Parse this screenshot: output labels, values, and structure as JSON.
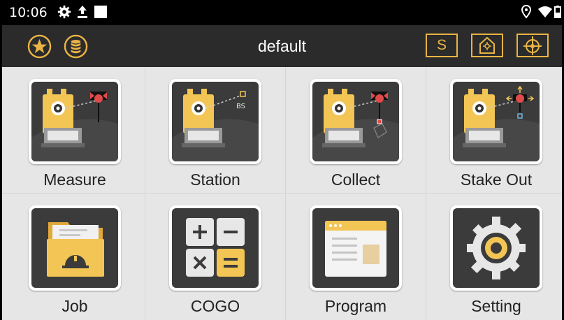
{
  "status_bar": {
    "time": "10:06",
    "icons": [
      "gear-icon",
      "upload-icon",
      "square-icon",
      "location-icon",
      "wifi-icon",
      "battery-icon"
    ]
  },
  "app_bar": {
    "title": "default",
    "left_icons": [
      "star-icon",
      "database-icon"
    ],
    "right_buttons": [
      {
        "label": "S",
        "name": "s-button"
      },
      {
        "label": "",
        "name": "home-target-icon"
      },
      {
        "label": "",
        "name": "crosshair-icon"
      }
    ],
    "accent": "#e9b445"
  },
  "menu": {
    "items": [
      {
        "label": "Measure",
        "icon": "total-station-measure-icon"
      },
      {
        "label": "Station",
        "icon": "total-station-backsight-icon",
        "caption": "BS"
      },
      {
        "label": "Collect",
        "icon": "total-station-collect-icon"
      },
      {
        "label": "Stake Out",
        "icon": "total-station-stakeout-icon"
      },
      {
        "label": "Job",
        "icon": "folder-icon"
      },
      {
        "label": "COGO",
        "icon": "calculator-icon"
      },
      {
        "label": "Program",
        "icon": "program-window-icon"
      },
      {
        "label": "Setting",
        "icon": "gear-settings-icon"
      }
    ]
  },
  "colors": {
    "tile_bg": "#3b3b3b",
    "yellow": "#f2c555",
    "grid_bg": "#e6e6e6"
  }
}
